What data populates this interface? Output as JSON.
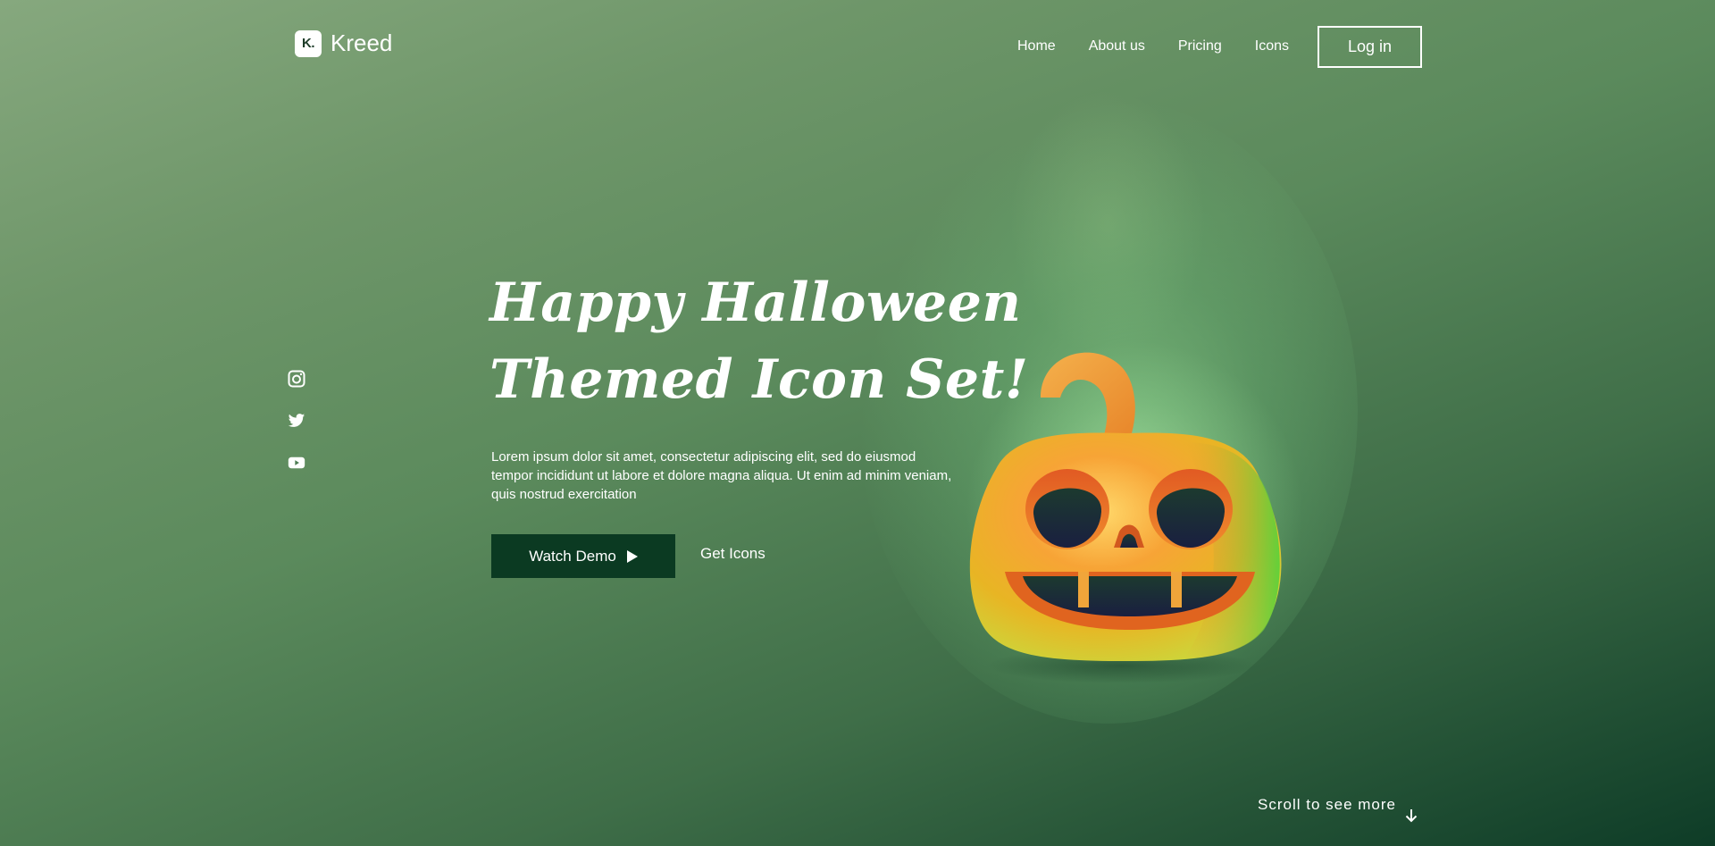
{
  "brand": {
    "logo_mark": "K.",
    "name": "Kreed"
  },
  "nav": {
    "items": [
      {
        "label": "Home"
      },
      {
        "label": "About us"
      },
      {
        "label": "Pricing"
      },
      {
        "label": "Icons"
      }
    ],
    "login_label": "Log in"
  },
  "social": {
    "icons": [
      "instagram-icon",
      "twitter-icon",
      "youtube-icon"
    ]
  },
  "hero": {
    "title_line1": "Happy Halloween",
    "title_line2": "Themed Icon Set!",
    "description": "Lorem ipsum dolor sit amet, consectetur adipiscing elit, sed do eiusmod tempor incididunt ut labore et dolore magna aliqua. Ut enim ad minim veniam, quis nostrud exercitation",
    "watch_demo_label": "Watch Demo",
    "get_icons_label": "Get Icons"
  },
  "illustration": {
    "icon": "pumpkin-icon"
  },
  "scroll": {
    "label": "Scroll to see more"
  },
  "colors": {
    "primary_dark": "#0b3a22",
    "background_light": "#86a87e",
    "background_dark": "#0e3c27",
    "text": "#ffffff"
  }
}
